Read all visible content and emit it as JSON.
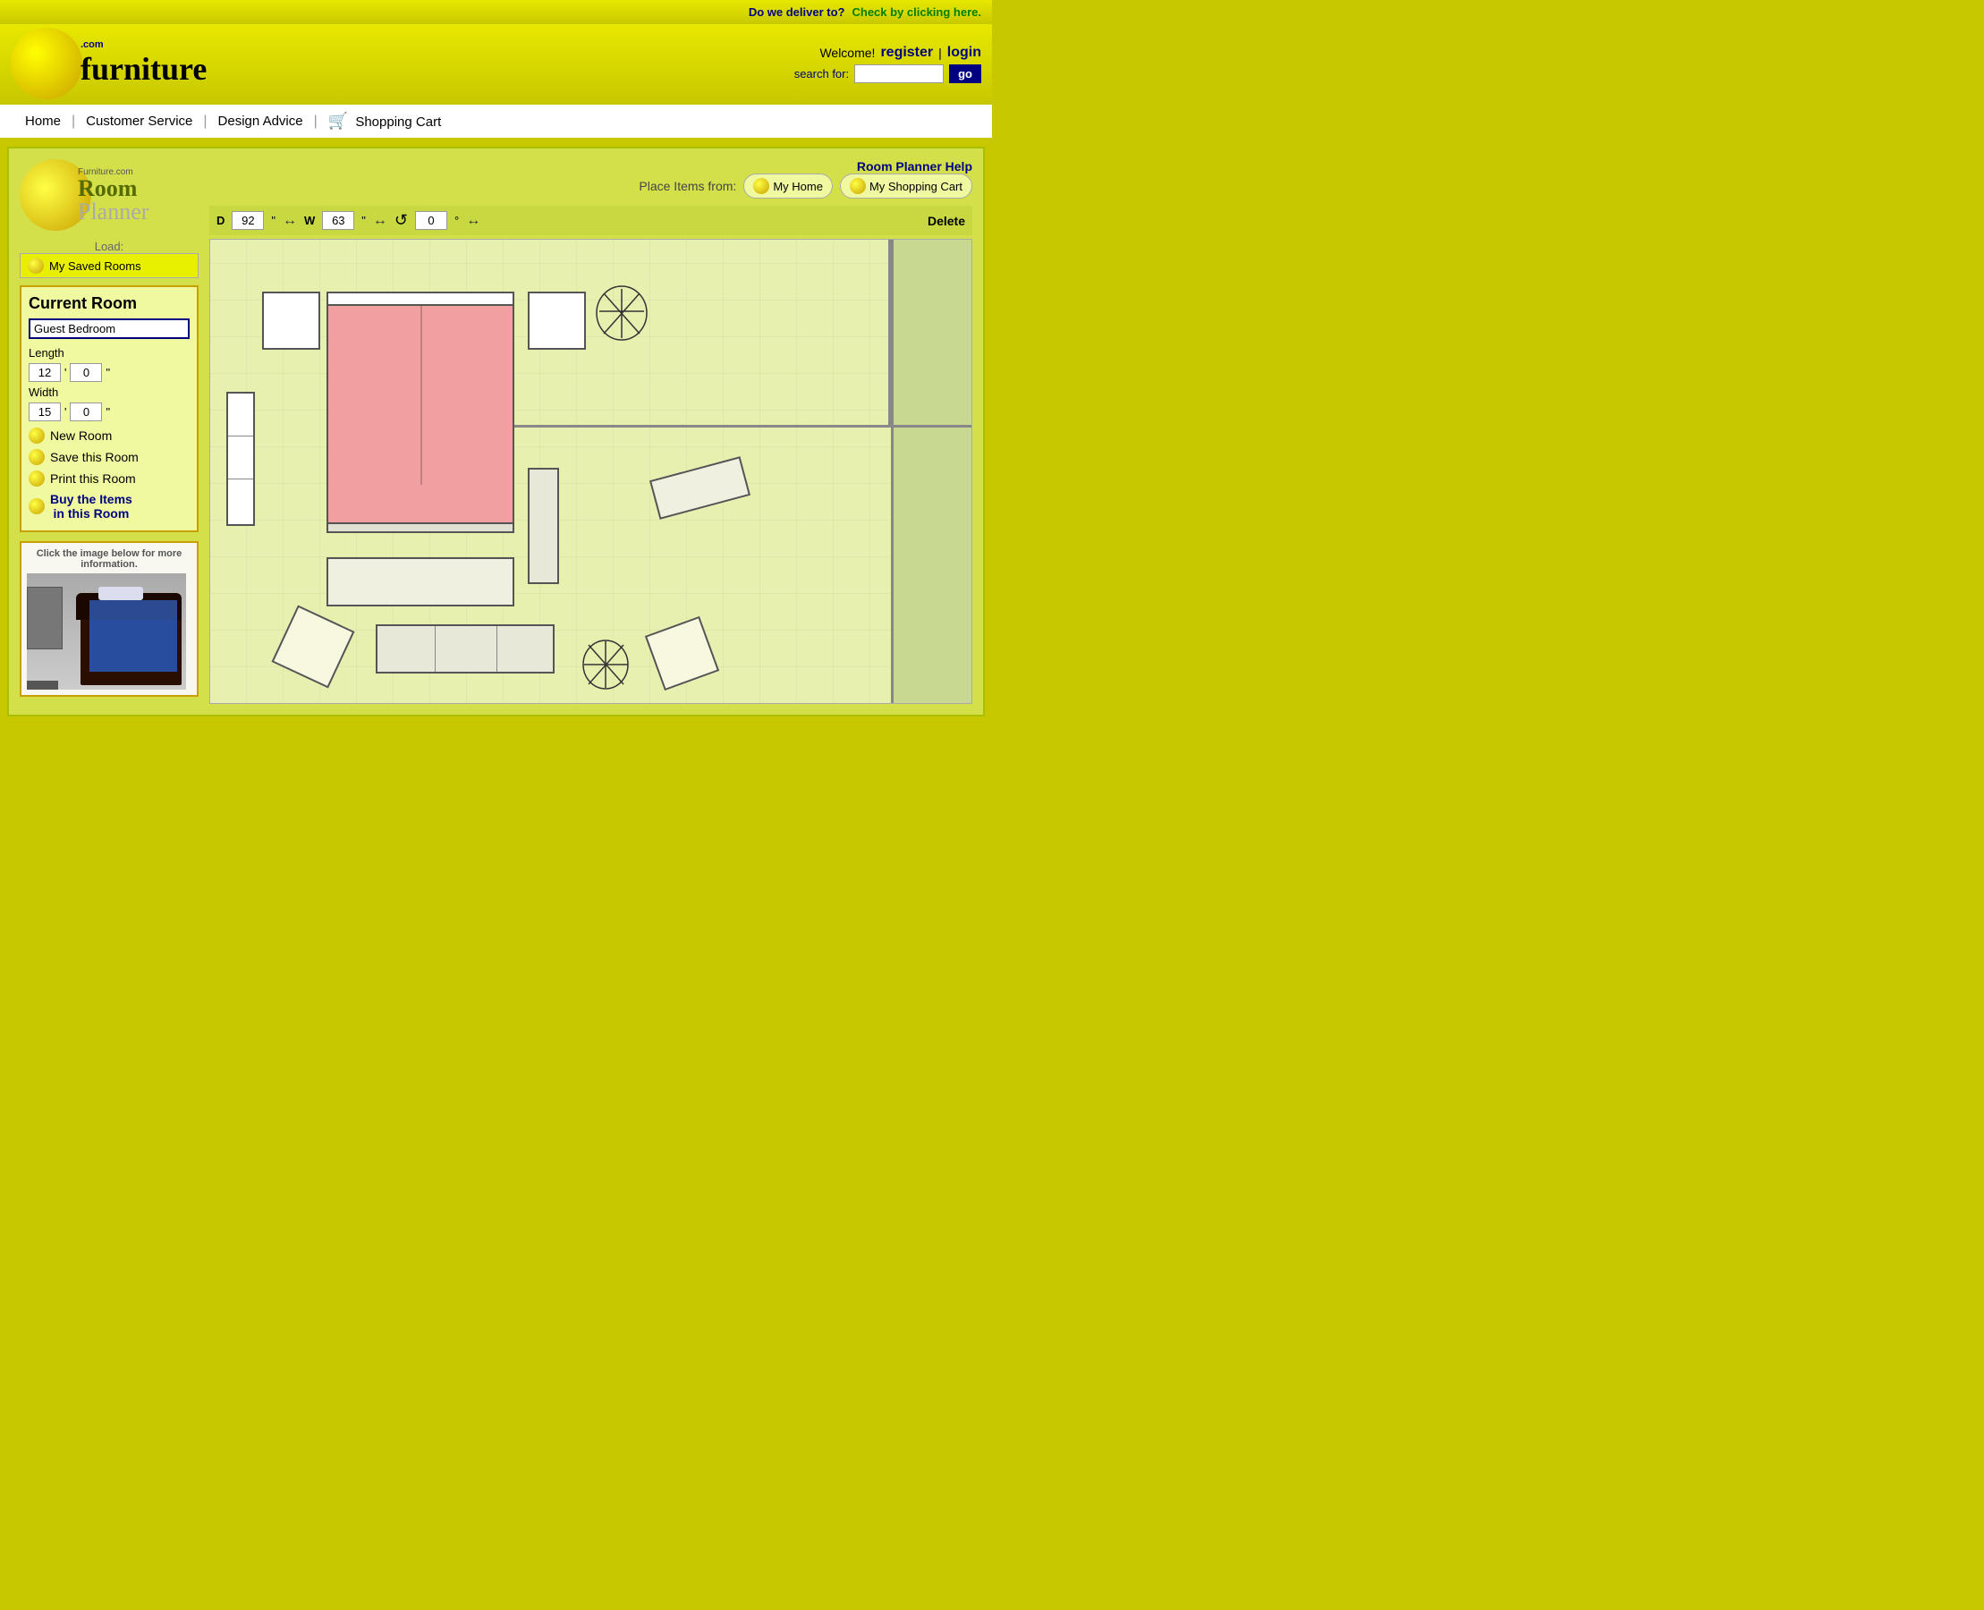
{
  "site": {
    "name": "furniture.com",
    "logo_com": ".com",
    "logo_main": "furniture"
  },
  "top_bar": {
    "delivery_question": "Do we deliver to?",
    "delivery_link": "Check by clicking here."
  },
  "header": {
    "welcome": "Welcome!",
    "register": "register",
    "separator": "|",
    "login": "login",
    "search_label": "search for:",
    "search_value": "",
    "go_button": "go"
  },
  "nav": {
    "items": [
      {
        "label": "Home",
        "id": "home"
      },
      {
        "label": "Customer Service",
        "id": "customer-service"
      },
      {
        "label": "Design Advice",
        "id": "design-advice"
      },
      {
        "label": "Shopping Cart",
        "id": "shopping-cart"
      }
    ]
  },
  "room_planner": {
    "help_link": "Room Planner Help",
    "logo_com": "Furniture.com",
    "logo_room": "Room",
    "logo_planner": "Planner",
    "load_label": "Load:",
    "load_btn": "My Saved Rooms",
    "place_items_label": "Place Items from:",
    "place_my_home": "My Home",
    "place_my_cart": "My Shopping Cart",
    "toolbar": {
      "d_label": "D",
      "d_value": "92",
      "d_unit": "\"",
      "w_label": "W",
      "w_value": "63",
      "w_unit": "\"",
      "rotate_value": "0",
      "rotate_unit": "°",
      "delete_label": "Delete"
    },
    "current_room": {
      "title": "Current Room",
      "name_value": "Guest Bedroom",
      "length_label": "Length",
      "length_ft": "12",
      "length_in": "0",
      "length_unit": "\"",
      "width_label": "Width",
      "width_ft": "15",
      "width_in": "0",
      "width_unit": "\""
    },
    "actions": {
      "new_room": "New Room",
      "save_room": "Save this Room",
      "print_room": "Print this Room",
      "buy_items": "Buy the Items\nin this Room"
    },
    "info_panel": {
      "label": "Click the image below for more information."
    }
  }
}
